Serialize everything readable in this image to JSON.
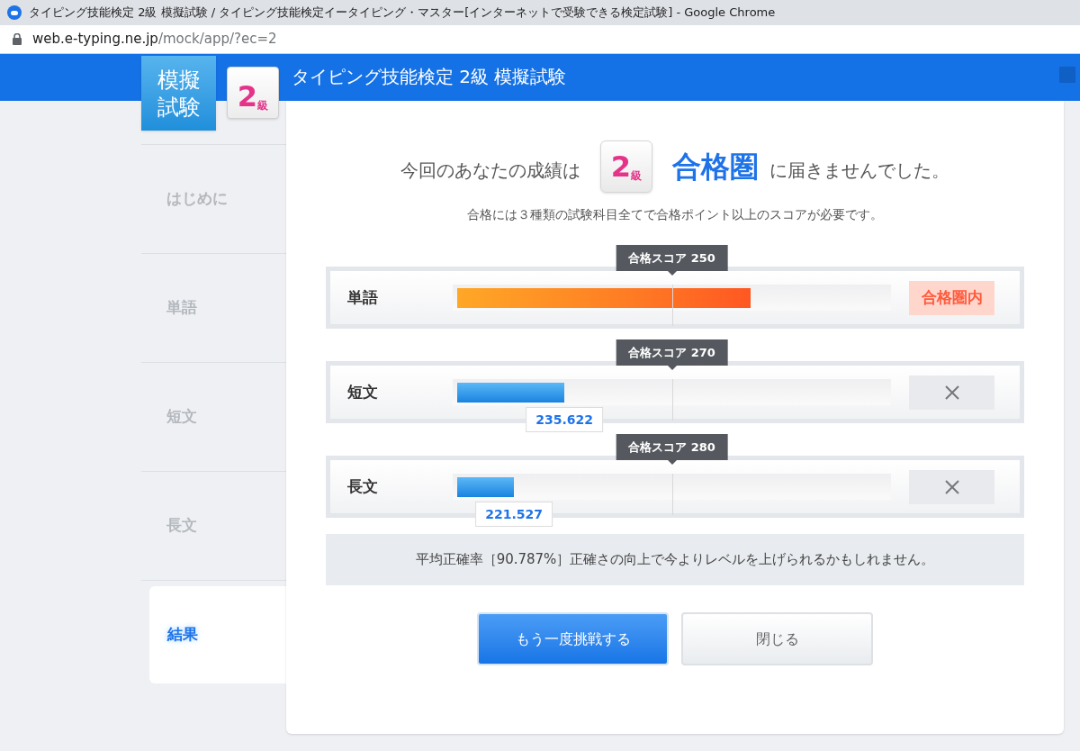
{
  "browser": {
    "tab_title": "タイピング技能検定 2級 模擬試験 / タイピング技能検定イータイピング・マスター[インターネットで受験できる検定試験] - Google Chrome",
    "url_domain": "web.e-typing.ne.jp",
    "url_path": "/mock/app/?ec=2"
  },
  "header": {
    "logo_lines": [
      "模擬",
      "試験"
    ],
    "grade_number": "2",
    "grade_unit": "級",
    "title": "タイピング技能検定 2級 模擬試験"
  },
  "sidebar": {
    "items": [
      {
        "label": "はじめに",
        "selected": false
      },
      {
        "label": "単語",
        "selected": false
      },
      {
        "label": "短文",
        "selected": false
      },
      {
        "label": "長文",
        "selected": false
      },
      {
        "label": "結果",
        "selected": true
      }
    ]
  },
  "result": {
    "lead": "今回のあなたの成績は",
    "grade_number": "2",
    "grade_unit": "級",
    "zone": "合格圏",
    "tail": "に届きませんでした。",
    "note": "合格には３種類の試験科目全てで合格ポイント以上のスコアが必要です。",
    "rows": [
      {
        "label": "単語",
        "passed": true,
        "level": 0.68,
        "pass_score": "合格スコア 250",
        "verdict": "合格圏内"
      },
      {
        "label": "短文",
        "passed": false,
        "level": 0.255,
        "pass_score": "合格スコア 270",
        "score": "235.622"
      },
      {
        "label": "長文",
        "passed": false,
        "level": 0.14,
        "pass_score": "合格スコア 280",
        "score": "221.527"
      }
    ],
    "accuracy": "平均正確率［90.787%］正確さの向上で今よりレベルを上げられるかもしれません。",
    "buttons": [
      {
        "label": "もう一度挑戦する",
        "kind": "primary"
      },
      {
        "label": "閉じる",
        "kind": "secondary"
      }
    ]
  }
}
